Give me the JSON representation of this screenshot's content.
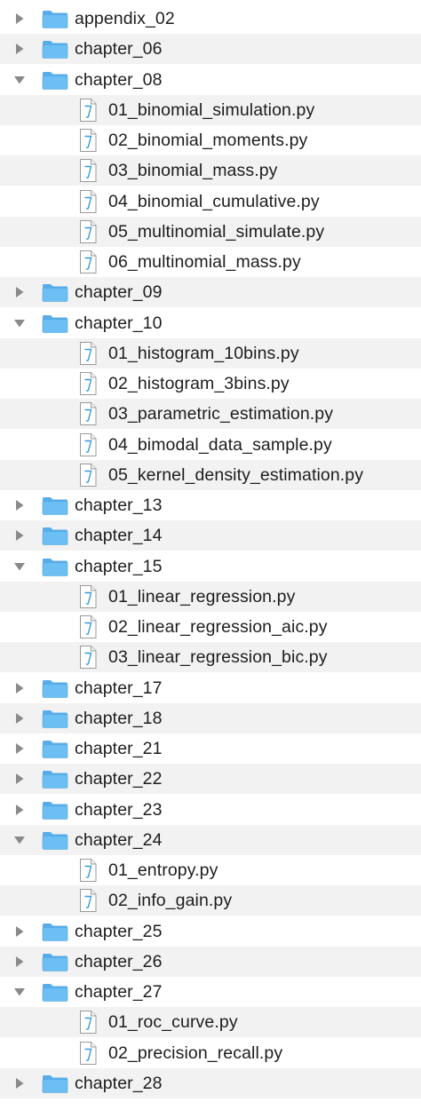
{
  "tree": {
    "rows": [
      {
        "type": "folder",
        "name": "appendix_02",
        "expanded": false
      },
      {
        "type": "folder",
        "name": "chapter_06",
        "expanded": false
      },
      {
        "type": "folder",
        "name": "chapter_08",
        "expanded": true
      },
      {
        "type": "file",
        "name": "01_binomial_simulation.py"
      },
      {
        "type": "file",
        "name": "02_binomial_moments.py"
      },
      {
        "type": "file",
        "name": "03_binomial_mass.py"
      },
      {
        "type": "file",
        "name": "04_binomial_cumulative.py"
      },
      {
        "type": "file",
        "name": "05_multinomial_simulate.py"
      },
      {
        "type": "file",
        "name": "06_multinomial_mass.py"
      },
      {
        "type": "folder",
        "name": "chapter_09",
        "expanded": false
      },
      {
        "type": "folder",
        "name": "chapter_10",
        "expanded": true
      },
      {
        "type": "file",
        "name": "01_histogram_10bins.py"
      },
      {
        "type": "file",
        "name": "02_histogram_3bins.py"
      },
      {
        "type": "file",
        "name": "03_parametric_estimation.py"
      },
      {
        "type": "file",
        "name": "04_bimodal_data_sample.py"
      },
      {
        "type": "file",
        "name": "05_kernel_density_estimation.py"
      },
      {
        "type": "folder",
        "name": "chapter_13",
        "expanded": false
      },
      {
        "type": "folder",
        "name": "chapter_14",
        "expanded": false
      },
      {
        "type": "folder",
        "name": "chapter_15",
        "expanded": true
      },
      {
        "type": "file",
        "name": "01_linear_regression.py"
      },
      {
        "type": "file",
        "name": "02_linear_regression_aic.py"
      },
      {
        "type": "file",
        "name": "03_linear_regression_bic.py"
      },
      {
        "type": "folder",
        "name": "chapter_17",
        "expanded": false
      },
      {
        "type": "folder",
        "name": "chapter_18",
        "expanded": false
      },
      {
        "type": "folder",
        "name": "chapter_21",
        "expanded": false
      },
      {
        "type": "folder",
        "name": "chapter_22",
        "expanded": false
      },
      {
        "type": "folder",
        "name": "chapter_23",
        "expanded": false
      },
      {
        "type": "folder",
        "name": "chapter_24",
        "expanded": true
      },
      {
        "type": "file",
        "name": "01_entropy.py"
      },
      {
        "type": "file",
        "name": "02_info_gain.py"
      },
      {
        "type": "folder",
        "name": "chapter_25",
        "expanded": false
      },
      {
        "type": "folder",
        "name": "chapter_26",
        "expanded": false
      },
      {
        "type": "folder",
        "name": "chapter_27",
        "expanded": true
      },
      {
        "type": "file",
        "name": "01_roc_curve.py"
      },
      {
        "type": "file",
        "name": "02_precision_recall.py"
      },
      {
        "type": "folder",
        "name": "chapter_28",
        "expanded": false
      }
    ]
  },
  "colors": {
    "row_alt": "#f2f2f2",
    "folder_body": "#6cbff3",
    "folder_tab": "#58acea",
    "folder_edge": "#4a9fdc",
    "file_outline": "#9a9a9a",
    "file_glyph": "#3a9ad9",
    "disclosure": "#8a8a8a",
    "text": "#1d1d1d"
  },
  "icons": {
    "folder": "folder-icon",
    "file": "python-file-icon",
    "collapsed": "disclosure-triangle-right-icon",
    "expanded": "disclosure-triangle-down-icon"
  }
}
